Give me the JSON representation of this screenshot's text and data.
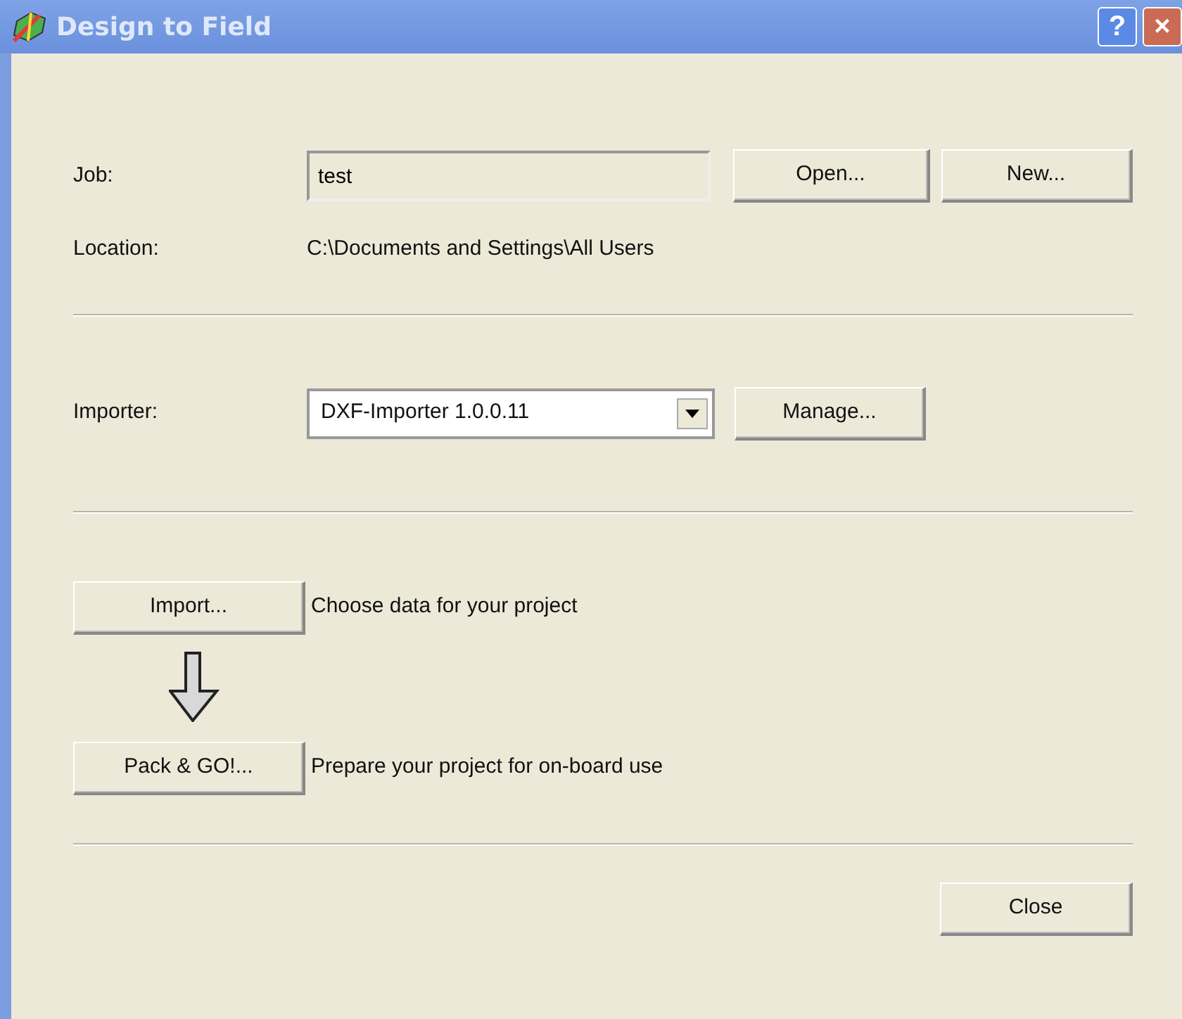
{
  "window": {
    "title": "Design to Field",
    "buttons": [
      "?",
      "×"
    ]
  },
  "job": {
    "label": "Job:",
    "value": "test",
    "buttons": [
      "Open...",
      "New..."
    ]
  },
  "location": {
    "label": "Location:",
    "value": "C:\\Documents and Settings\\All Users"
  },
  "importer": {
    "label": "Importer:",
    "value": "DXF-Importer 1.0.0.11",
    "button": "Manage..."
  },
  "steps": [
    {
      "button": "Import...",
      "description": "Choose data for your project"
    },
    {
      "button": "Pack & GO!...",
      "description": "Prepare your project for on-board use"
    }
  ],
  "close_button": "Close"
}
